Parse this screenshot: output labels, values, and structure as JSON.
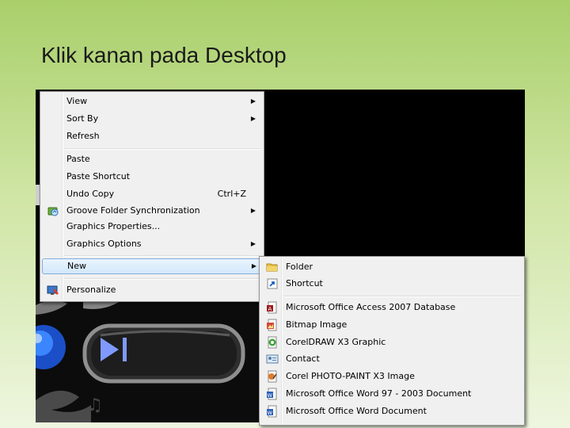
{
  "slide": {
    "title": "Klik kanan pada Desktop"
  },
  "context_menu": {
    "items": [
      {
        "label": "View",
        "submenu": true
      },
      {
        "label": "Sort By",
        "submenu": true
      },
      {
        "label": "Refresh"
      },
      {
        "label": "Paste"
      },
      {
        "label": "Paste Shortcut"
      },
      {
        "label": "Undo Copy",
        "shortcut": "Ctrl+Z"
      },
      {
        "label": "Groove Folder Synchronization",
        "submenu": true,
        "icon": "groove-sync-icon"
      },
      {
        "label": "Graphics Properties..."
      },
      {
        "label": "Graphics Options",
        "submenu": true
      },
      {
        "label": "New",
        "submenu": true,
        "highlighted": true
      },
      {
        "label": "Personalize",
        "icon": "personalize-icon"
      }
    ]
  },
  "new_submenu": {
    "items": [
      {
        "label": "Folder",
        "icon": "folder-icon"
      },
      {
        "label": "Shortcut",
        "icon": "shortcut-icon"
      },
      {
        "label": "Microsoft Office Access 2007 Database",
        "icon": "access-file-icon"
      },
      {
        "label": "Bitmap Image",
        "icon": "bitmap-file-icon"
      },
      {
        "label": "CorelDRAW X3 Graphic",
        "icon": "coreldraw-file-icon"
      },
      {
        "label": "Contact",
        "icon": "contact-file-icon"
      },
      {
        "label": "Corel PHOTO-PAINT X3 Image",
        "icon": "photopaint-file-icon"
      },
      {
        "label": "Microsoft Office Word 97 - 2003 Document",
        "icon": "word-doc-icon"
      },
      {
        "label": "Microsoft Office Word Document",
        "icon": "word-docx-icon"
      }
    ]
  },
  "colors": {
    "menu_bg": "#f0f0f0",
    "highlight": "#d3e8fb",
    "slide_green": "#a9cf6a"
  }
}
